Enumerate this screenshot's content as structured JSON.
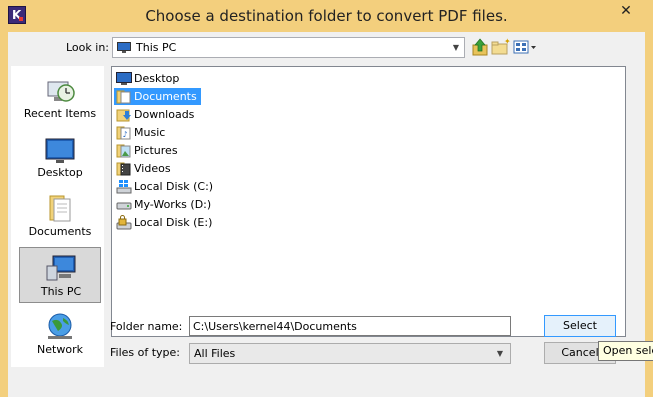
{
  "window": {
    "title": "Choose a destination folder to convert PDF files.",
    "close_glyph": "✕",
    "app_icon_letter": "K",
    "accent": "#f3cf7d"
  },
  "toolbar": {
    "look_in_label": "Look in:",
    "look_in_value": "This PC",
    "up_icon": "up-folder-icon",
    "new_folder_icon": "new-folder-icon",
    "view_menu_icon": "view-menu-icon"
  },
  "places": [
    {
      "label": "Recent Items",
      "icon": "recent-items-icon"
    },
    {
      "label": "Desktop",
      "icon": "desktop-icon"
    },
    {
      "label": "Documents",
      "icon": "documents-icon"
    },
    {
      "label": "This PC",
      "icon": "this-pc-icon",
      "selected": true
    },
    {
      "label": "Network",
      "icon": "network-icon"
    }
  ],
  "files": [
    {
      "name": "Desktop",
      "icon": "desktop-icon"
    },
    {
      "name": "Documents",
      "icon": "documents-folder-icon",
      "selected": true
    },
    {
      "name": "Downloads",
      "icon": "downloads-folder-icon"
    },
    {
      "name": "Music",
      "icon": "music-folder-icon"
    },
    {
      "name": "Pictures",
      "icon": "pictures-folder-icon"
    },
    {
      "name": "Videos",
      "icon": "videos-folder-icon"
    },
    {
      "name": "Local Disk (C:)",
      "icon": "windows-drive-icon"
    },
    {
      "name": "My-Works (D:)",
      "icon": "drive-icon"
    },
    {
      "name": "Local Disk (E:)",
      "icon": "locked-drive-icon"
    }
  ],
  "form": {
    "folder_name_label": "Folder name:",
    "folder_name_value": "C:\\Users\\kernel44\\Documents",
    "files_of_type_label": "Files of type:",
    "files_of_type_value": "All Files"
  },
  "buttons": {
    "select": "Select",
    "cancel": "Cancel"
  },
  "tooltip": {
    "text": "Open sele"
  }
}
